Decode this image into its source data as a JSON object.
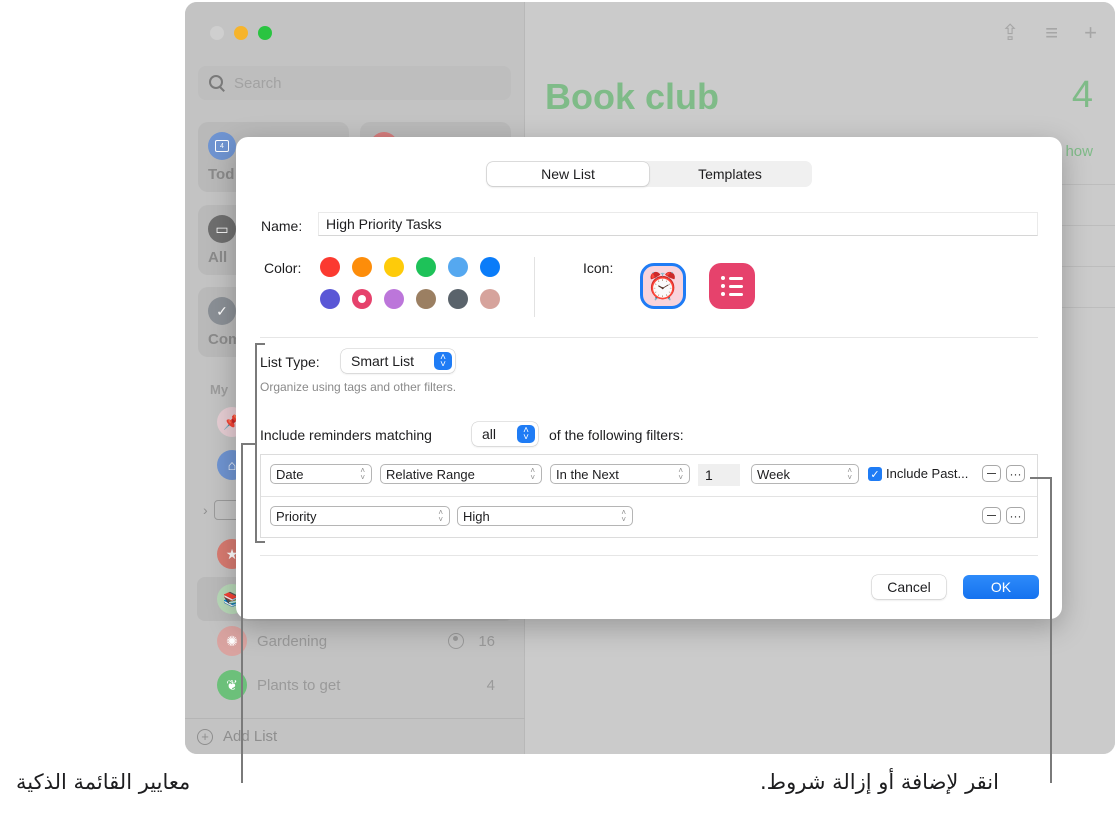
{
  "window": {
    "sidebar": {
      "search_placeholder": "Search",
      "smart_tiles": [
        {
          "label": "Tod",
          "icon": "calendar-icon",
          "badge": "4",
          "color": "#6f94d1"
        },
        {
          "label": "",
          "icon": "flag-icon",
          "color": "#d47c7c"
        },
        {
          "label": "All",
          "icon": "tray-icon",
          "color": "#6e6e6e"
        },
        {
          "label": "Com",
          "icon": "checkmark-icon",
          "color": "#8a8f95"
        }
      ],
      "section_header": "My",
      "lists": [
        {
          "name": "",
          "icon": "pin-icon",
          "color": "#e6cdd3"
        },
        {
          "name": "",
          "icon": "house-icon",
          "color": "#6f94d1"
        },
        {
          "name": "",
          "icon": "folder-icon",
          "color": "#c3c3c3"
        },
        {
          "name": "",
          "icon": "star-icon",
          "color": "#d77a70"
        },
        {
          "name": "",
          "icon": "books-icon",
          "color": "#b7d8b7",
          "selected": true
        },
        {
          "name": "Gardening",
          "icon": "sun-icon",
          "color": "#d9a3a0",
          "count": "16",
          "shared": true
        },
        {
          "name": "Plants to get",
          "icon": "leaf-icon",
          "color": "#6cc07a",
          "count": "4"
        }
      ],
      "add_list_label": "Add List"
    },
    "main": {
      "title": "Book club",
      "count": "4",
      "show_link": "how",
      "toolbar_icons": [
        "share-icon",
        "list-options-icon",
        "add-icon"
      ],
      "accent_color": "#7fbb88"
    }
  },
  "dialog": {
    "tabs": [
      {
        "label": "New List",
        "active": true
      },
      {
        "label": "Templates",
        "active": false
      }
    ],
    "name_label": "Name:",
    "name_value": "High Priority Tasks",
    "color_label": "Color:",
    "colors": [
      "#fb3a30",
      "#fd8d0a",
      "#fecb0a",
      "#1ec259",
      "#55a8f0",
      "#0a7cf9",
      "#5a57d6",
      "#e6426c",
      "#bc76da",
      "#9b7f62",
      "#5a636b",
      "#d6a39c"
    ],
    "selected_color_index": 7,
    "icon_label": "Icon:",
    "icon_options": [
      {
        "name": "alarm-clock-icon",
        "selected": true,
        "glyph": "⏰"
      },
      {
        "name": "list-bullets-icon",
        "selected": false
      }
    ],
    "list_type_label": "List Type:",
    "list_type_value": "Smart List",
    "list_type_hint": "Organize using tags and other filters.",
    "match_prefix": "Include reminders matching",
    "match_value": "all",
    "match_suffix": "of the following filters:",
    "filters": [
      {
        "field": "Date",
        "operator": "Relative Range",
        "qualifier": "In the Next",
        "amount": "1",
        "unit": "Week",
        "include_past_checked": true,
        "include_past_label": "Include Past..."
      },
      {
        "field": "Priority",
        "operator": "High"
      }
    ],
    "cancel_label": "Cancel",
    "ok_label": "OK"
  },
  "callouts": {
    "smart_list_criteria": "معايير القائمة الذكية",
    "add_remove_conditions": "انقر لإضافة أو إزالة شروط."
  }
}
